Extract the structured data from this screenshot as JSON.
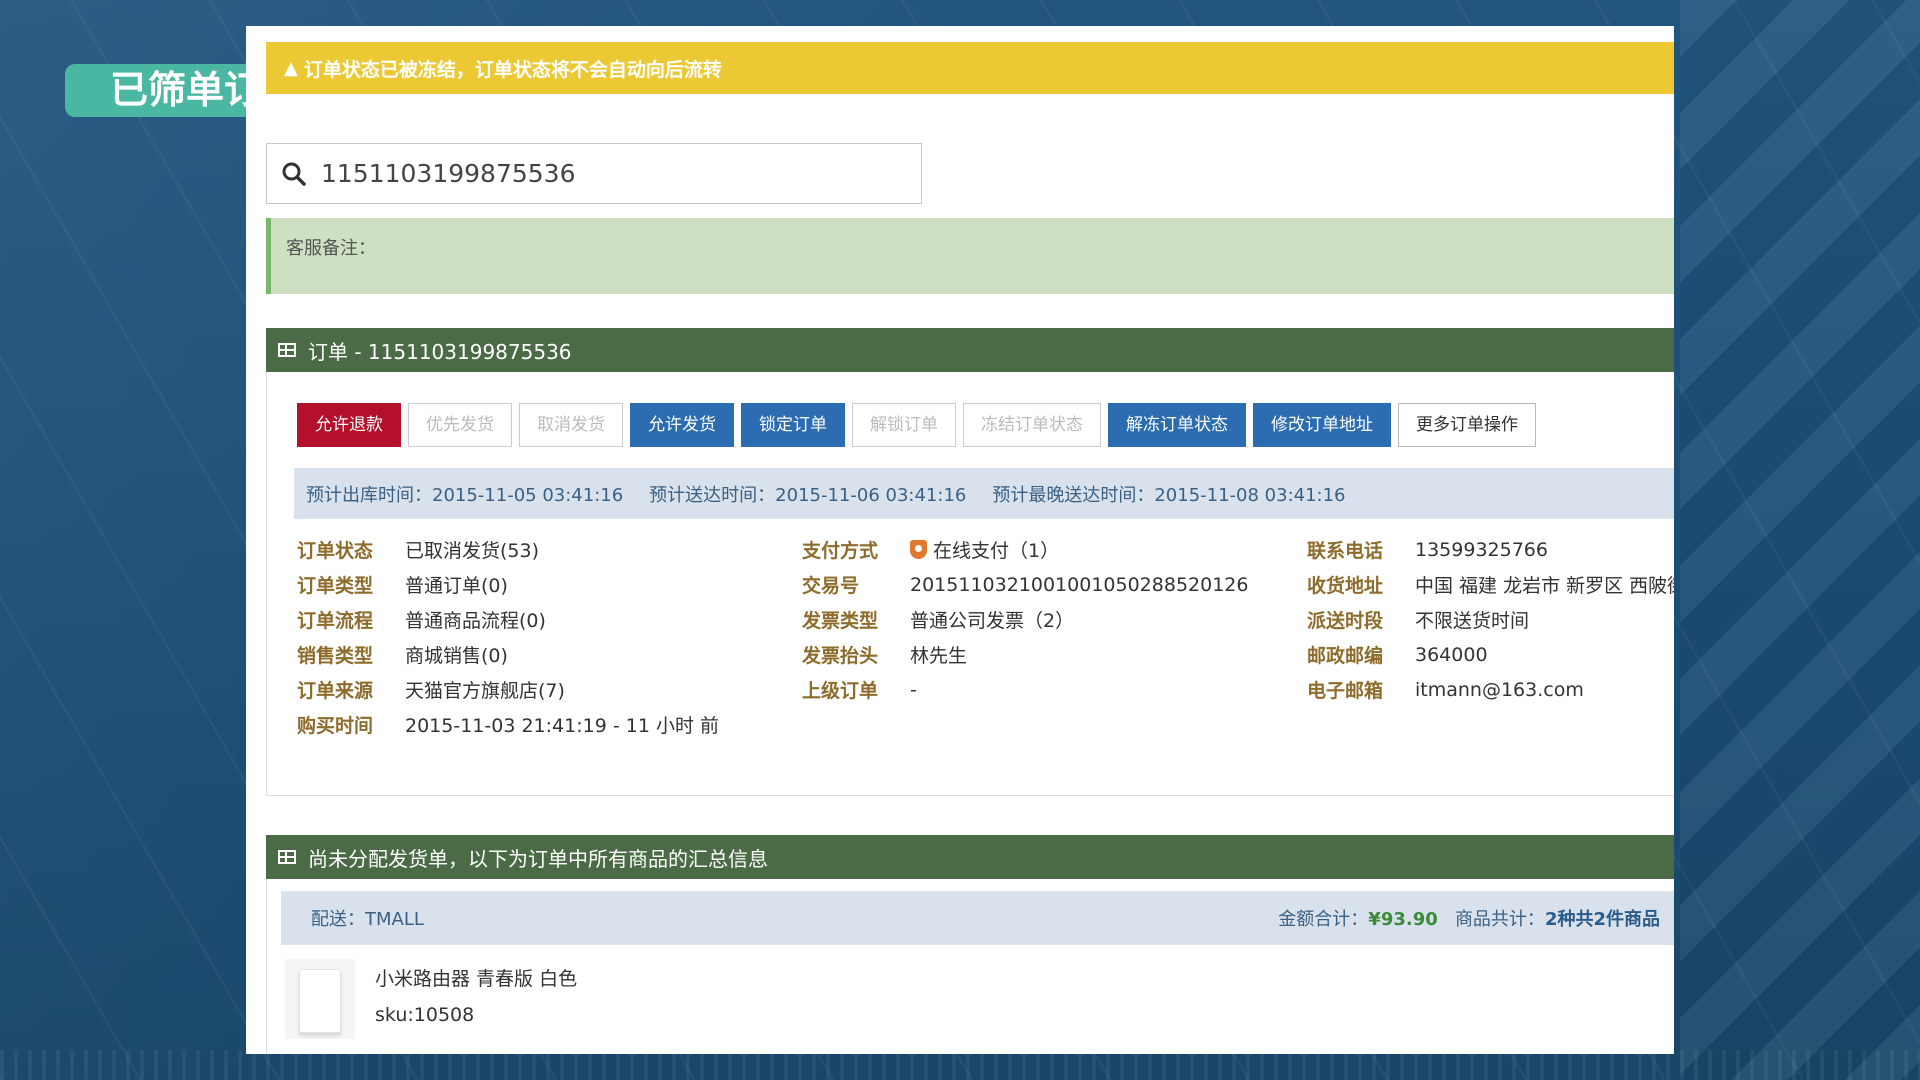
{
  "slide": {
    "tag": "已筛单订"
  },
  "warning": {
    "text": "订单状态已被冻结，订单状态将不会自动向后流转"
  },
  "search": {
    "value": "1151103199875536"
  },
  "note": {
    "label": "客服备注："
  },
  "order_panel": {
    "title": "订单 - 1151103199875536",
    "buttons": [
      "允许退款",
      "优先发货",
      "取消发货",
      "允许发货",
      "锁定订单",
      "解锁订单",
      "冻结订单状态",
      "解冻订单状态",
      "修改订单地址",
      "更多订单操作"
    ],
    "times": {
      "out": "预计出库时间：2015-11-05 03:41:16",
      "deliver": "预计送达时间：2015-11-06 03:41:16",
      "latest": "预计最晚送达时间：2015-11-08 03:41:16"
    },
    "info_col1": [
      {
        "k": "订单状态",
        "v": "已取消发货(53)"
      },
      {
        "k": "订单类型",
        "v": "普通订单(0)"
      },
      {
        "k": "订单流程",
        "v": "普通商品流程(0)"
      },
      {
        "k": "销售类型",
        "v": "商城销售(0)"
      },
      {
        "k": "订单来源",
        "v": "天猫官方旗舰店(7)"
      },
      {
        "k": "购买时间",
        "v": "2015-11-03 21:41:19 - 11 小时 前"
      }
    ],
    "info_col2": [
      {
        "k": "支付方式",
        "v": "在线支付（1）"
      },
      {
        "k": "交易号",
        "v": "2015110321001001050288520126"
      },
      {
        "k": "发票类型",
        "v": "普通公司发票（2）"
      },
      {
        "k": "发票抬头",
        "v": "林先生"
      },
      {
        "k": "上级订单",
        "v": "-"
      }
    ],
    "info_col3": [
      {
        "k": "联系电话",
        "v": "13599325766"
      },
      {
        "k": "收货地址",
        "v": "中国 福建 龙岩市 新罗区 西陂街道"
      },
      {
        "k": "派送时段",
        "v": "不限送货时间"
      },
      {
        "k": "邮政邮编",
        "v": "364000"
      },
      {
        "k": "电子邮箱",
        "v": "itmann@163.com"
      }
    ]
  },
  "shipment_panel": {
    "title": "尚未分配发货单，以下为订单中所有商品的汇总信息",
    "carrier": "配送：TMALL",
    "amount_label": "金额合计：",
    "amount": "¥93.90",
    "count_label": "商品共计：",
    "count": "2种共2件商品",
    "product": {
      "name": "小米路由器 青春版 白色",
      "sku": "sku:10508"
    }
  },
  "colors": {
    "warning": "#ecc934",
    "panel_head": "#4a6b46",
    "btn_blue": "#2b6db0",
    "btn_red": "#b5102b",
    "note_bg": "#cde0c2"
  }
}
